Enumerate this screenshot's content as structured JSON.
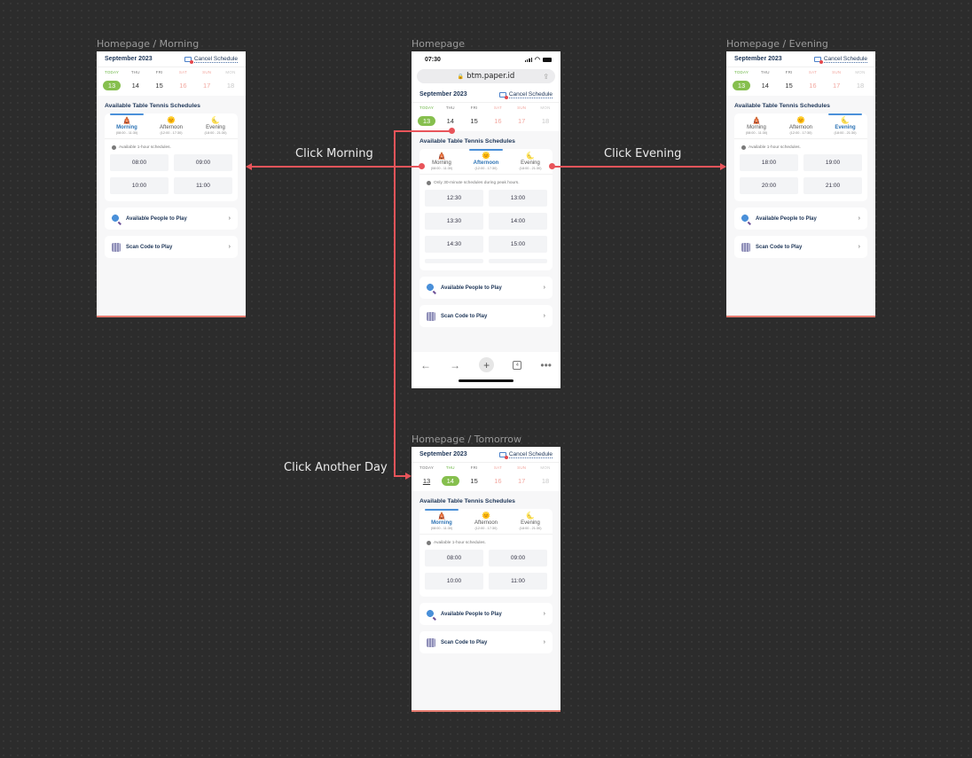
{
  "frames": {
    "morning": {
      "label": "Homepage / Morning"
    },
    "main": {
      "label": "Homepage"
    },
    "evening": {
      "label": "Homepage / Evening"
    },
    "tomorrow": {
      "label": "Homepage / Tomorrow"
    }
  },
  "status_bar": {
    "time": "07:30"
  },
  "browser": {
    "url": "btm.paper.id",
    "tab_count": "4"
  },
  "header": {
    "month": "September 2023",
    "cancel_label": "Cancel Schedule"
  },
  "days": [
    {
      "name": "TODAY",
      "num": "13"
    },
    {
      "name": "THU",
      "num": "14"
    },
    {
      "name": "FRI",
      "num": "15"
    },
    {
      "name": "SAT",
      "num": "16"
    },
    {
      "name": "SUN",
      "num": "17"
    },
    {
      "name": "MON",
      "num": "18"
    }
  ],
  "section_title": "Available Table Tennis Schedules",
  "periods": [
    {
      "name": "Morning",
      "range": "(08:00 - 11:30)",
      "icon": "sunrise-icon"
    },
    {
      "name": "Afternoon",
      "range": "(12:00 - 17:30)",
      "icon": "sun-icon"
    },
    {
      "name": "Evening",
      "range": "(18:00 - 21:30)",
      "icon": "moon-icon"
    }
  ],
  "notes": {
    "hourly": "Available 1-hour schedules.",
    "peak": "Only 30-minute schedules during peak hours."
  },
  "slots": {
    "morning": [
      "08:00",
      "09:00",
      "10:00",
      "11:00"
    ],
    "afternoon": [
      "12:30",
      "13:00",
      "13:30",
      "14:00",
      "14:30",
      "15:00"
    ],
    "evening": [
      "18:00",
      "19:00",
      "20:00",
      "21:00"
    ]
  },
  "links": {
    "people": "Available People to Play",
    "scan": "Scan Code to Play"
  },
  "annotations": {
    "click_morning": "Click Morning",
    "click_evening": "Click Evening",
    "click_another_day": "Click Another Day"
  }
}
